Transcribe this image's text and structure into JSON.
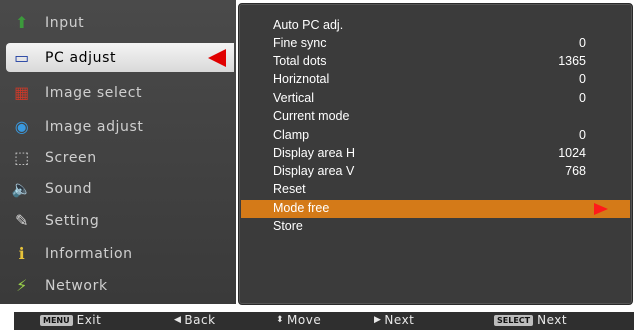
{
  "menu": {
    "items": [
      {
        "label": "Input",
        "icon": "input-icon",
        "glyph": "⬆"
      },
      {
        "label": "PC adjust",
        "icon": "pc-adjust-icon",
        "glyph": "▭"
      },
      {
        "label": "Image select",
        "icon": "image-select-icon",
        "glyph": "▦"
      },
      {
        "label": "Image adjust",
        "icon": "image-adjust-icon",
        "glyph": "◉"
      },
      {
        "label": "Screen",
        "icon": "screen-icon",
        "glyph": "⬚"
      },
      {
        "label": "Sound",
        "icon": "sound-icon",
        "glyph": "🔈"
      },
      {
        "label": "Setting",
        "icon": "setting-icon",
        "glyph": "✎"
      },
      {
        "label": "Information",
        "icon": "information-icon",
        "glyph": "ℹ"
      },
      {
        "label": "Network",
        "icon": "network-icon",
        "glyph": "⚡"
      }
    ],
    "active_index": 1
  },
  "panel": {
    "rows": [
      {
        "label": "Auto PC adj.",
        "value": ""
      },
      {
        "label": "Fine sync",
        "value": "0"
      },
      {
        "label": "Total dots",
        "value": "1365"
      },
      {
        "label": "Horiznotal",
        "value": "0"
      },
      {
        "label": "Vertical",
        "value": "0"
      },
      {
        "label": "Current mode",
        "value": ""
      },
      {
        "label": "Clamp",
        "value": "0"
      },
      {
        "label": "Display area H",
        "value": "1024"
      },
      {
        "label": "Display area V",
        "value": "768"
      },
      {
        "label": "Reset",
        "value": ""
      },
      {
        "label": "Mode free",
        "value": ""
      },
      {
        "label": "Store",
        "value": ""
      }
    ],
    "selected_index": 10
  },
  "bottombar": {
    "exit_key": "MENU",
    "exit_label": "Exit",
    "back_label": "Back",
    "move_label": "Move",
    "next_label": "Next",
    "select_key": "SELECT",
    "select_label": "Next"
  },
  "colors": {
    "selected_row": "#d47a18",
    "arrow": "#e00000",
    "panel_bg": "#3b3b3b"
  }
}
